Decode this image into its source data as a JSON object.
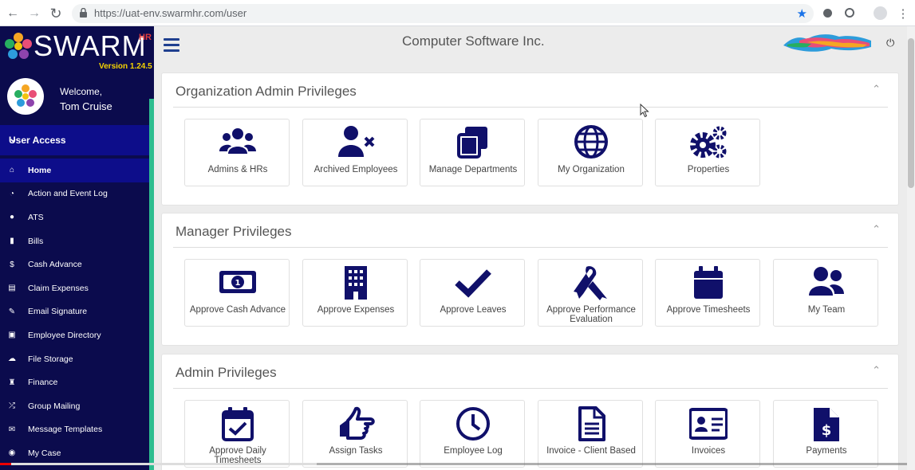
{
  "browser": {
    "url": "https://uat-env.swarmhr.com/user",
    "back_icon": "←",
    "forward_icon": "→",
    "reload_icon": "↻",
    "star_icon": "★",
    "menu_icon": "⋮"
  },
  "sidebar": {
    "logo_text": "SWARM",
    "logo_hr": "HR",
    "version": "Version 1.24.5",
    "welcome": "Welcome,",
    "username": "Tom Cruise",
    "section_label": "User Access",
    "section_chevron": "⌄",
    "items": [
      {
        "label": "Home",
        "icon": "⌂",
        "active": true
      },
      {
        "label": "Action and Event Log",
        "icon": "◔"
      },
      {
        "label": "ATS",
        "icon": "●"
      },
      {
        "label": "Bills",
        "icon": "▮"
      },
      {
        "label": "Cash Advance",
        "icon": "$"
      },
      {
        "label": "Claim Expenses",
        "icon": "▤"
      },
      {
        "label": "Email Signature",
        "icon": "✎"
      },
      {
        "label": "Employee Directory",
        "icon": "▣"
      },
      {
        "label": "File Storage",
        "icon": "☁"
      },
      {
        "label": "Finance",
        "icon": "♜"
      },
      {
        "label": "Group Mailing",
        "icon": "⤮"
      },
      {
        "label": "Message Templates",
        "icon": "✉"
      },
      {
        "label": "My Case",
        "icon": "◉"
      }
    ]
  },
  "header": {
    "company": "Computer Software Inc.",
    "power_icon": "⏻"
  },
  "panels": [
    {
      "title": "Organization Admin Privileges",
      "chevron": "⌃",
      "tiles": [
        {
          "label": "Admins & HRs",
          "icon": "users-icon"
        },
        {
          "label": "Archived Employees",
          "icon": "user-times-icon"
        },
        {
          "label": "Manage Departments",
          "icon": "clone-icon"
        },
        {
          "label": "My Organization",
          "icon": "globe-icon"
        },
        {
          "label": "Properties",
          "icon": "cogs-icon"
        }
      ]
    },
    {
      "title": "Manager Privileges",
      "chevron": "⌃",
      "tiles": [
        {
          "label": "Approve Cash Advance",
          "icon": "money-bill-icon"
        },
        {
          "label": "Approve Expenses",
          "icon": "building-icon"
        },
        {
          "label": "Approve Leaves",
          "icon": "check-icon"
        },
        {
          "label": "Approve Performance Evaluation",
          "icon": "ribbon-icon"
        },
        {
          "label": "Approve Timesheets",
          "icon": "calendar-icon"
        },
        {
          "label": "My Team",
          "icon": "user-friends-icon"
        }
      ]
    },
    {
      "title": "Admin Privileges",
      "chevron": "⌃",
      "tiles": [
        {
          "label": "Approve Daily Timesheets",
          "icon": "calendar-check-icon"
        },
        {
          "label": "Assign Tasks",
          "icon": "hand-point-icon"
        },
        {
          "label": "Employee Log",
          "icon": "clock-icon"
        },
        {
          "label": "Invoice - Client Based",
          "icon": "file-alt-icon"
        },
        {
          "label": "Invoices",
          "icon": "id-card-icon"
        },
        {
          "label": "Payments",
          "icon": "file-invoice-dollar-icon"
        }
      ]
    }
  ],
  "colors": {
    "sidebar_bg": "#0b0b4d",
    "sidebar_active": "#0d0d8a",
    "icon_navy": "#10106a",
    "accent_green": "#2dbd8f"
  }
}
